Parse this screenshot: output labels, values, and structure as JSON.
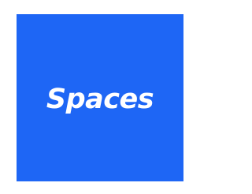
{
  "logo": {
    "text": "Spaces",
    "background_color": "#1E66F5",
    "text_color": "#FFFFFF"
  }
}
